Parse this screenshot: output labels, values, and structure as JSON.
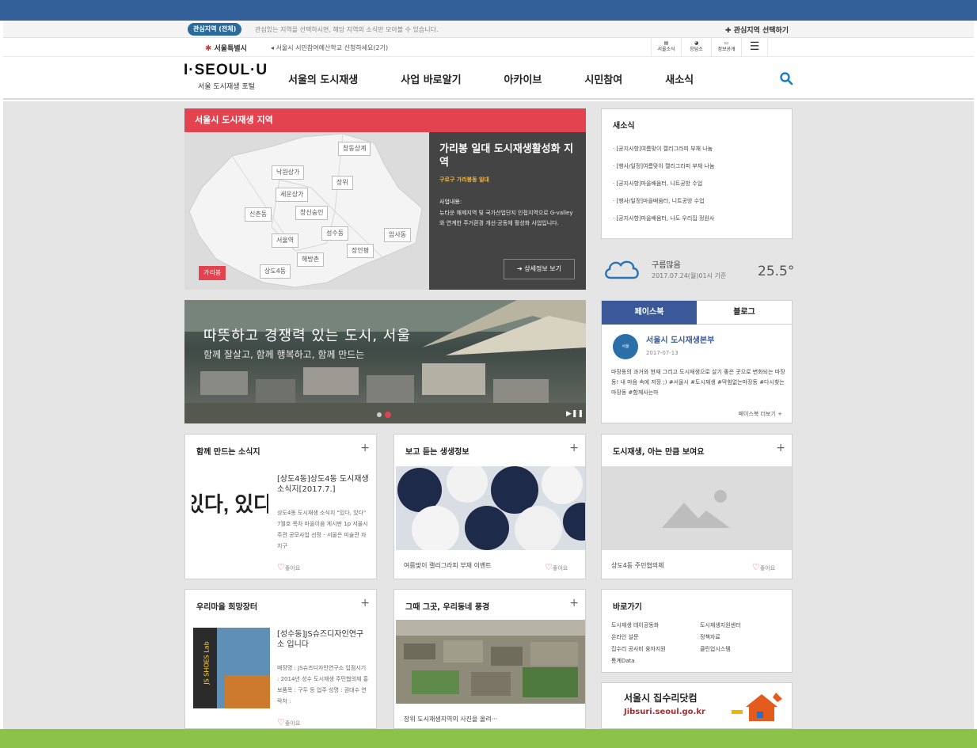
{
  "interest_bar": {
    "pill": "관심지역 (전체)",
    "desc": "관심있는 지역을 선택하시면, 해당 지역의 소식만 모아볼 수 있습니다.",
    "select_label": "관심지역 선택하기"
  },
  "gov_bar": {
    "seoul_label": "서울특별시",
    "notice": "서울시 시민참여예산학교 신청하세요(2기)",
    "icons": [
      {
        "name": "seoul-news-icon",
        "label": "서울소식"
      },
      {
        "name": "eungdapso-icon",
        "label": "응답소"
      },
      {
        "name": "info-open-icon",
        "label": "정보공개"
      }
    ]
  },
  "header": {
    "logo_text": "I·SEOUL·U",
    "logo_sub": "서울 도시재생 포털",
    "nav": [
      "서울의 도시재생",
      "사업 바로알기",
      "아카이브",
      "시민참여",
      "새소식"
    ]
  },
  "region": {
    "heading": "서울시 도시재생 지역",
    "map_tags": [
      "창동상계",
      "낙원상가",
      "장위",
      "세운상가",
      "신촌동",
      "창신숭인",
      "성수동",
      "암사동",
      "서울역",
      "장안평",
      "해방촌",
      "상도4동",
      "가리봉"
    ],
    "active_tag": "가리봉",
    "title": "가리봉 일대 도시재생활성화 지역",
    "subtitle": "구로구 가리봉동 일대",
    "desc_label": "사업내용:",
    "desc": "뉴타운 해제지역 및 국가산업단지 인접지역으로 G-valley와 연계한 주거환경 개선·공동체 활성화 사업입니다.",
    "more": "상세정보 보기"
  },
  "news": {
    "title": "새소식",
    "items": [
      "[공지사항]여름맞이 캘리그라피 부채 나눔",
      "[행사/일정]여름맞이 캘리그라피 부채 나눔",
      "[공지사항]마을배움터, 니트공방 수업",
      "[행사/일정]마을배움터, 니트공방 수업",
      "[공지사항]마을배움터, 나도 우리집 정원사"
    ]
  },
  "weather": {
    "condition": "구름많음",
    "datetime": "2017.07.24(월)01시 기준",
    "temp": "25.5°"
  },
  "banner": {
    "headline": "따뜻하고 경쟁력 있는 도시, 서울",
    "subline": "함께 잘살고, 함께 행복하고, 함께 만드는"
  },
  "sns": {
    "tab_facebook": "페이스북",
    "tab_blog": "블로그",
    "account": "서울시 도시재생본부",
    "date": "2017-07-13",
    "text": "마장동의 과거와 현재 그리고 도시재생으로 살기 좋은 곳으로 변화되는 마장동! 내 마음 속에 저장 ;) #서울시 #도시재생 #막힘없는마장동 #다시찾는마장동 #함께사는마",
    "more": "페이스북 더보기 +"
  },
  "cards": {
    "c1": {
      "title": "함께 만드는 소식지",
      "art": "있다, 있다",
      "item_title": "[상도4동]상도4동 도시재생소식지[2017.7.]",
      "item_body": "상도4동 도시재생 소식지 \"있다, 있다\" 7월호 목차 마을이음 게시판 1p 서울시 주관 공모사업 선정 - 서울은 미술관 자치구",
      "like": "좋아요"
    },
    "c2": {
      "title": "보고 듣는 생생정보",
      "caption": "여름맞이 캘리그라피 부채 이벤트",
      "like": "좋아요"
    },
    "c3": {
      "title": "도시재생, 아는 만큼 보여요",
      "caption": "상도4동 주민협의체",
      "like": "좋아요"
    },
    "c4": {
      "title": "우리마을 희망장터",
      "shop_sign": "JS SHOES Lab",
      "item_title": "[성수동]JS슈즈디자인연구소 입니다",
      "item_body": "매장명 : JS슈즈디자인연구소 입점시기 : 2014년 성수 도시재생 주민협의체 홍보품목 : 구두 등 업주 성명 : 권대수 연락처 :",
      "like": "좋아요"
    },
    "c5": {
      "title": "그때 그곳, 우리동네 풍경",
      "caption": "장위 도시재생지역의 사진을 올려···"
    },
    "c6": {
      "title": "바로가기",
      "links": [
        "도시재생 데이공동화",
        "도시재생지원센터",
        "온라인 설문",
        "정책자료",
        "집수리 공사비 융자지원",
        "클린업시스템",
        "통계Data"
      ]
    }
  },
  "jibsuri": {
    "title": "서울시 집수리닷컴",
    "url": "Jibsuri.seoul.go.kr"
  },
  "colors": {
    "top_band": "#34609a",
    "accent_red": "#e2434e",
    "footer_green": "#8bc24a",
    "fb_blue": "#3b5998"
  }
}
